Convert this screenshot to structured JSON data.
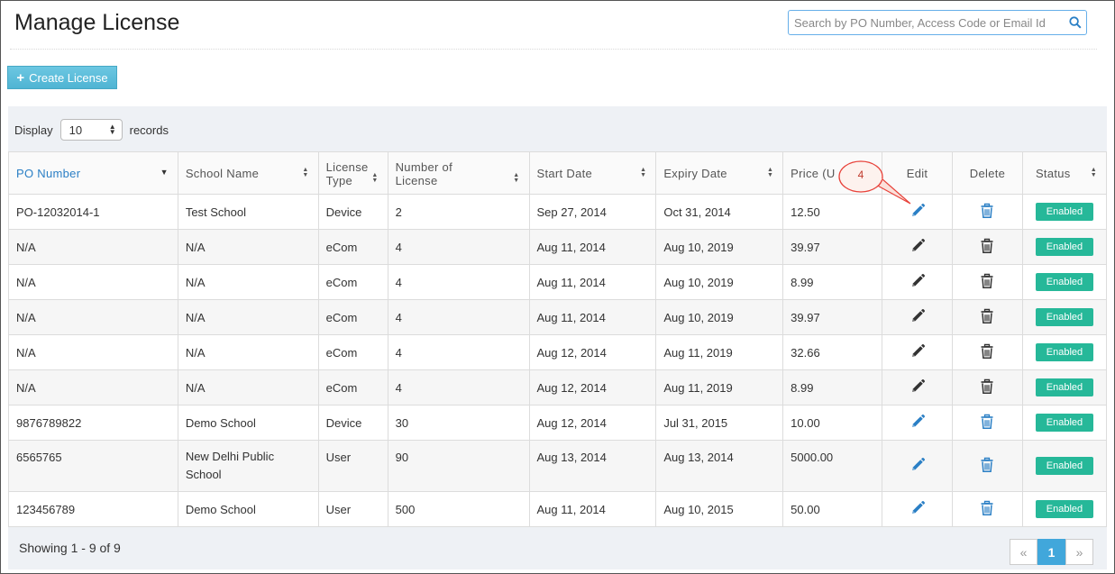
{
  "page": {
    "title": "Manage License",
    "search_placeholder": "Search by PO Number, Access Code or Email Id",
    "create_label": "Create License"
  },
  "display": {
    "prefix": "Display",
    "value": "10",
    "suffix": "records"
  },
  "table": {
    "columns": [
      {
        "label": "PO Number",
        "sort": "desc"
      },
      {
        "label": "School Name",
        "sort": "both"
      },
      {
        "label": "License Type",
        "sort": "both"
      },
      {
        "label": "Number of License",
        "sort": "both"
      },
      {
        "label": "Start Date",
        "sort": "both"
      },
      {
        "label": "Expiry Date",
        "sort": "both"
      },
      {
        "label": "Price (U",
        "sort": "none"
      },
      {
        "label": "Edit",
        "sort": "none"
      },
      {
        "label": "Delete",
        "sort": "none"
      },
      {
        "label": "Status",
        "sort": "both"
      }
    ],
    "rows": [
      {
        "po": "PO-12032014-1",
        "school": "Test School",
        "type": "Device",
        "count": "2",
        "start": "Sep 27, 2014",
        "expiry": "Oct 31, 2014",
        "price": "12.50",
        "icon_color": "blue",
        "status": "Enabled"
      },
      {
        "po": "N/A",
        "school": "N/A",
        "type": "eCom",
        "count": "4",
        "start": "Aug 11, 2014",
        "expiry": "Aug 10, 2019",
        "price": "39.97",
        "icon_color": "black",
        "status": "Enabled"
      },
      {
        "po": "N/A",
        "school": "N/A",
        "type": "eCom",
        "count": "4",
        "start": "Aug 11, 2014",
        "expiry": "Aug 10, 2019",
        "price": "8.99",
        "icon_color": "black",
        "status": "Enabled"
      },
      {
        "po": "N/A",
        "school": "N/A",
        "type": "eCom",
        "count": "4",
        "start": "Aug 11, 2014",
        "expiry": "Aug 10, 2019",
        "price": "39.97",
        "icon_color": "black",
        "status": "Enabled"
      },
      {
        "po": "N/A",
        "school": "N/A",
        "type": "eCom",
        "count": "4",
        "start": "Aug 12, 2014",
        "expiry": "Aug 11, 2019",
        "price": "32.66",
        "icon_color": "black",
        "status": "Enabled"
      },
      {
        "po": "N/A",
        "school": "N/A",
        "type": "eCom",
        "count": "4",
        "start": "Aug 12, 2014",
        "expiry": "Aug 11, 2019",
        "price": "8.99",
        "icon_color": "black",
        "status": "Enabled"
      },
      {
        "po": "9876789822",
        "school": "Demo School",
        "type": "Device",
        "count": "30",
        "start": "Aug 12, 2014",
        "expiry": "Jul 31, 2015",
        "price": "10.00",
        "icon_color": "blue",
        "status": "Enabled"
      },
      {
        "po": "6565765",
        "school": "New Delhi Public School",
        "type": "User",
        "count": "90",
        "start": "Aug 13, 2014",
        "expiry": "Aug 13, 2014",
        "price": "5000.00",
        "icon_color": "blue",
        "status": "Enabled"
      },
      {
        "po": "123456789",
        "school": "Demo School",
        "type": "User",
        "count": "500",
        "start": "Aug 11, 2014",
        "expiry": "Aug 10, 2015",
        "price": "50.00",
        "icon_color": "blue",
        "status": "Enabled"
      }
    ]
  },
  "footer": {
    "showing": "Showing 1 - 9 of 9",
    "pager": {
      "prev": "«",
      "current": "1",
      "next": "»"
    }
  },
  "callout": {
    "label": "4"
  },
  "colors": {
    "accent_blue": "#2a7fc5",
    "enabled_green": "#26b899",
    "create_button": "#5bc0de",
    "callout_red": "#e8423a"
  },
  "icons": {
    "search": "search-icon",
    "plus": "plus-icon",
    "edit": "pencil-icon",
    "delete": "trash-icon"
  }
}
